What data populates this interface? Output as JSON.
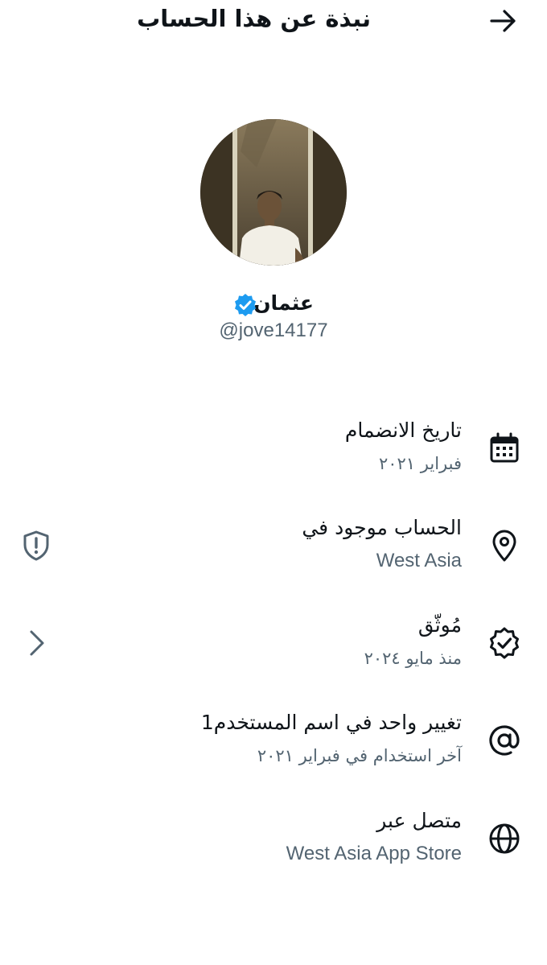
{
  "header": {
    "title": "نبذة عن هذا الحساب",
    "back_icon": "arrow-right-icon"
  },
  "profile": {
    "name": "عثمان",
    "handle": "@jove14177",
    "verified_badge_color": "#1d9bf0"
  },
  "rows": [
    {
      "title": "تاريخ الانضمام",
      "subtitle": "فبراير ٢٠٢١",
      "icon": "calendar-icon"
    },
    {
      "title": "الحساب موجود في",
      "subtitle": "West Asia",
      "icon": "location-pin-icon",
      "left_icon": "shield-alert-icon"
    },
    {
      "title": "مُوثّق",
      "subtitle": "منذ مايو ٢٠٢٤",
      "icon": "verified-check-icon",
      "left_icon": "chevron-right-icon"
    },
    {
      "title": "تغيير واحد في اسم المستخدم1",
      "subtitle": "آخر استخدام في فبراير ٢٠٢١",
      "icon": "at-sign-icon"
    },
    {
      "title": "متصل عبر",
      "subtitle": "West Asia App Store",
      "icon": "globe-icon"
    }
  ],
  "colors": {
    "text_primary": "#0f1419",
    "text_secondary": "#536471",
    "accent": "#1d9bf0"
  }
}
